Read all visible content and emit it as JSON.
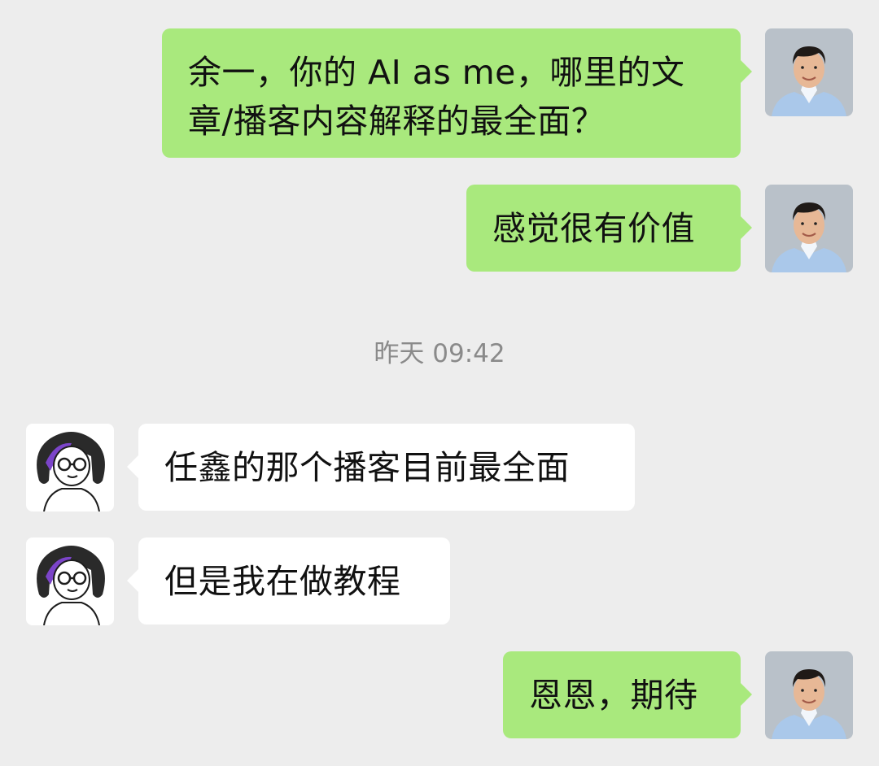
{
  "messages": [
    {
      "side": "me",
      "text": "余一，你的AI as me，哪里的文章/播客内容解释的最全面？",
      "line1": "余一，你的 AI as me，哪里的文",
      "line2": "章/播客内容解释的最全面？",
      "avatar": "man-portrait-avatar"
    },
    {
      "side": "me",
      "text": "感觉很有价值",
      "avatar": "man-portrait-avatar"
    },
    {
      "side": "them",
      "text": "任鑫的那个播客目前最全面",
      "avatar": "cartoon-woman-glasses-avatar"
    },
    {
      "side": "them",
      "text": "但是我在做教程",
      "avatar": "cartoon-woman-glasses-avatar"
    },
    {
      "side": "me",
      "text": "恩恩，期待",
      "avatar": "man-portrait-avatar"
    }
  ],
  "timestamp": "昨天 09:42",
  "colors": {
    "background": "#ededed",
    "my_bubble": "#a9e97d",
    "their_bubble": "#ffffff",
    "timestamp_text": "#8a8a8a"
  }
}
